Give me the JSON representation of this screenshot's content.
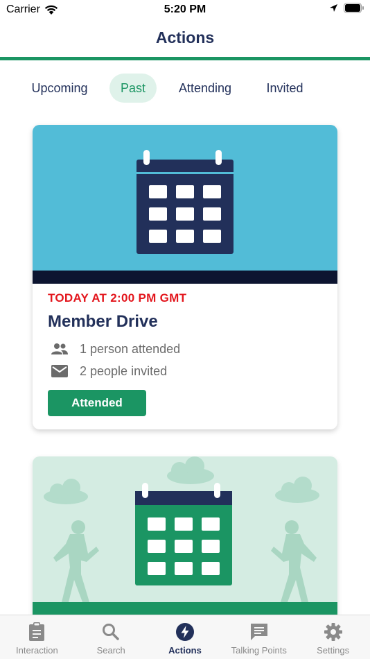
{
  "status_bar": {
    "carrier": "Carrier",
    "time": "5:20 PM"
  },
  "header": {
    "title": "Actions"
  },
  "tabs": [
    {
      "label": "Upcoming",
      "active": false
    },
    {
      "label": "Past",
      "active": true
    },
    {
      "label": "Attending",
      "active": false
    },
    {
      "label": "Invited",
      "active": false
    }
  ],
  "cards": [
    {
      "date": "TODAY AT 2:00 PM GMT",
      "title": "Member Drive",
      "attended": "1 person attended",
      "invited": "2 people invited",
      "status": "Attended"
    }
  ],
  "bottom_nav": [
    {
      "label": "Interaction",
      "icon": "clipboard-icon",
      "active": false
    },
    {
      "label": "Search",
      "icon": "search-icon",
      "active": false
    },
    {
      "label": "Actions",
      "icon": "lightning-icon",
      "active": true
    },
    {
      "label": "Talking Points",
      "icon": "chat-icon",
      "active": false
    },
    {
      "label": "Settings",
      "icon": "gear-icon",
      "active": false
    }
  ],
  "colors": {
    "navy": "#22305a",
    "green": "#1b9563",
    "alert_red": "#e3161d",
    "hero_blue": "#52bcd7",
    "hero_mint": "#d4ece2"
  }
}
